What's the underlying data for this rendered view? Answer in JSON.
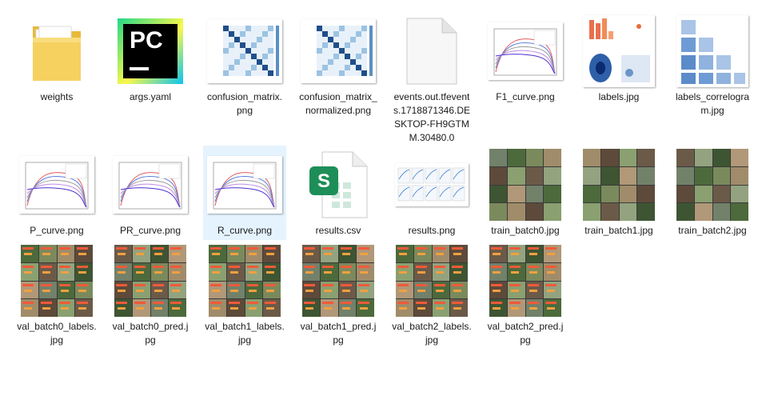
{
  "files": [
    {
      "name": "weights",
      "type": "folder"
    },
    {
      "name": "args.yaml",
      "type": "pycharm"
    },
    {
      "name": "confusion_matrix.png",
      "type": "matrix"
    },
    {
      "name": "confusion_matrix_normalized.png",
      "type": "matrix"
    },
    {
      "name": "events.out.tfevents.1718871346.DESKTOP-FH9GTMM.30480.0",
      "type": "blank"
    },
    {
      "name": "F1_curve.png",
      "type": "curve"
    },
    {
      "name": "labels.jpg",
      "type": "labels"
    },
    {
      "name": "labels_correlogram.jpg",
      "type": "correlogram"
    },
    {
      "name": "P_curve.png",
      "type": "curve"
    },
    {
      "name": "PR_curve.png",
      "type": "curve"
    },
    {
      "name": "R_curve.png",
      "type": "curve",
      "selected": true
    },
    {
      "name": "results.csv",
      "type": "sheet"
    },
    {
      "name": "results.png",
      "type": "results"
    },
    {
      "name": "train_batch0.jpg",
      "type": "photos"
    },
    {
      "name": "train_batch1.jpg",
      "type": "photos"
    },
    {
      "name": "train_batch2.jpg",
      "type": "photos"
    },
    {
      "name": "val_batch0_labels.jpg",
      "type": "val"
    },
    {
      "name": "val_batch0_pred.jpg",
      "type": "val"
    },
    {
      "name": "val_batch1_labels.jpg",
      "type": "val"
    },
    {
      "name": "val_batch1_pred.jpg",
      "type": "val"
    },
    {
      "name": "val_batch2_labels.jpg",
      "type": "val"
    },
    {
      "name": "val_batch2_pred.jpg",
      "type": "val"
    }
  ],
  "icons": {
    "pycharm_text": "PC",
    "sheet_letter": "S"
  },
  "colors": {
    "selection": "#e5f3ff",
    "folder": "#f3c94e",
    "pycharm_green": "#21d789",
    "sheet_green": "#1e8e58"
  }
}
